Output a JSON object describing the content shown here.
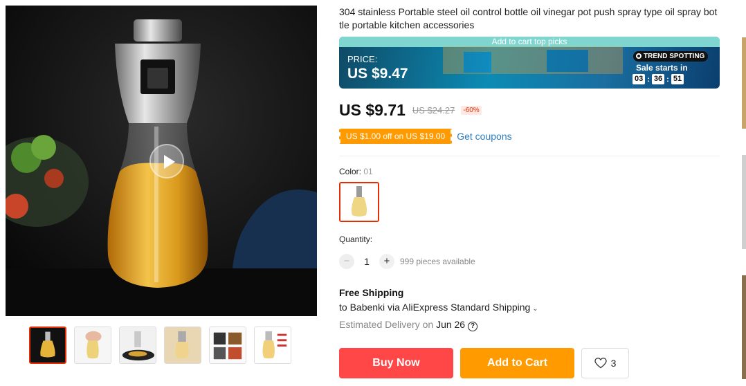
{
  "product": {
    "title": "304 stainless Portable steel oil control bottle oil vinegar pot push spray type oil spray bottle portable kitchen accessories"
  },
  "promo": {
    "top_label": "Add to cart top picks",
    "price_label": "PRICE:",
    "price": "US $9.47",
    "badge": "TREND SPOTTING",
    "sale_label": "Sale starts in",
    "timer": [
      "03",
      "36",
      "51"
    ]
  },
  "price": {
    "current": "US $9.71",
    "original": "US $24.27",
    "discount": "-60%"
  },
  "coupon": {
    "tag": "US $1.00 off on US $19.00",
    "link": "Get coupons"
  },
  "variant": {
    "label": "Color: ",
    "value": "01"
  },
  "quantity": {
    "label": "Quantity:",
    "minus": "−",
    "value": "1",
    "plus": "+",
    "available": "999 pieces available"
  },
  "shipping": {
    "title": "Free Shipping",
    "line": "to Babenki via AliExpress Standard Shipping",
    "delivery_label": "Estimated Delivery on ",
    "delivery_date": "Jun 26",
    "help": "?"
  },
  "actions": {
    "buy_now": "Buy Now",
    "add_to_cart": "Add to Cart",
    "wishlist_count": "3"
  },
  "icons": {
    "play": "play-icon",
    "heart": "heart-icon",
    "help": "question-circle-icon",
    "chevron": "chevron-down-icon"
  },
  "colors": {
    "buy_now": "#ff4747",
    "add_to_cart": "#ff9a00",
    "accent_red": "#e62e04",
    "link_blue": "#2b7bbd"
  }
}
